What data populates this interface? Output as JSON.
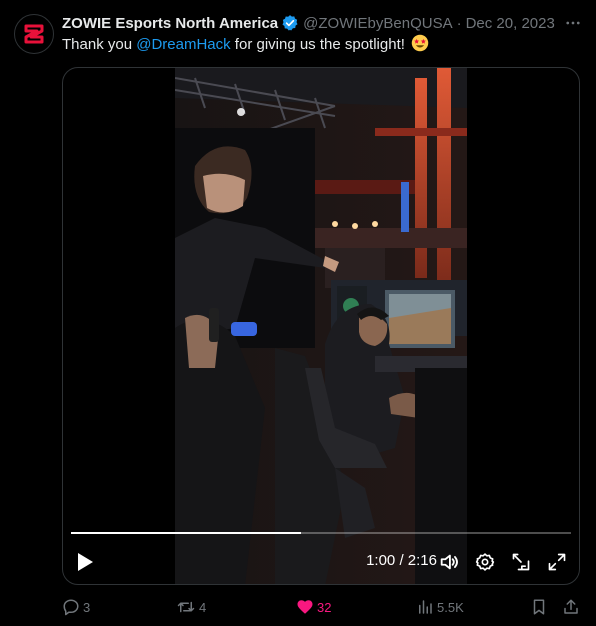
{
  "tweet": {
    "author_name": "ZOWIE Esports North America",
    "handle": "@ZOWIEbyBenQUSA",
    "separator": "·",
    "date": "Dec 20, 2023",
    "text_before": "Thank you ",
    "mention": "@DreamHack",
    "text_after": " for giving us the spotlight!",
    "emoji": "star-struck-emoji"
  },
  "video": {
    "progress": 0.46,
    "time_current": "1:00",
    "time_separator": " / ",
    "time_total": "2:16",
    "controls": [
      "play-icon",
      "volume-icon",
      "settings-icon",
      "popout-icon",
      "fullscreen-icon"
    ]
  },
  "actions": {
    "replies": "3",
    "reposts": "4",
    "likes": "32",
    "views": "5.5K"
  },
  "colors": {
    "accent": "#1d9bf0",
    "like": "#f91880",
    "muted": "#71767b",
    "brand_logo": "#e8113a"
  }
}
